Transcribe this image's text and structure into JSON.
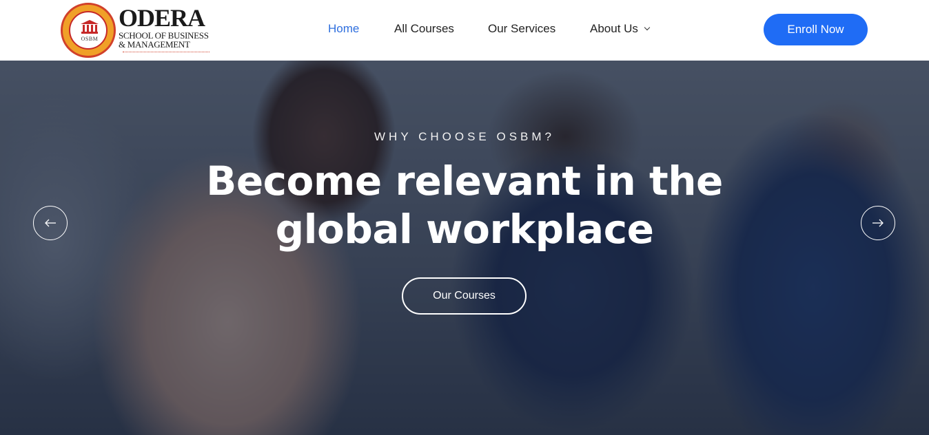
{
  "brand": {
    "seal_abbr": "OSBM",
    "name": "ODERA",
    "subtitle_line1": "SCHOOL OF BUSINESS",
    "subtitle_line2": "& MANAGEMENT"
  },
  "nav": {
    "items": [
      {
        "label": "Home",
        "active": true
      },
      {
        "label": "All Courses",
        "active": false
      },
      {
        "label": "Our Services",
        "active": false
      },
      {
        "label": "About Us",
        "active": false,
        "has_dropdown": true
      }
    ]
  },
  "header": {
    "enroll_label": "Enroll Now"
  },
  "hero": {
    "eyebrow": "WHY CHOOSE OSBM?",
    "headline_line1": "Become relevant in the",
    "headline_line2": "global workplace",
    "cta_label": "Our Courses",
    "prev_icon": "arrow-left-icon",
    "next_icon": "arrow-right-icon"
  },
  "colors": {
    "accent": "#1f6cf5",
    "nav_active": "#2f6fde",
    "overlay": "#182238"
  }
}
